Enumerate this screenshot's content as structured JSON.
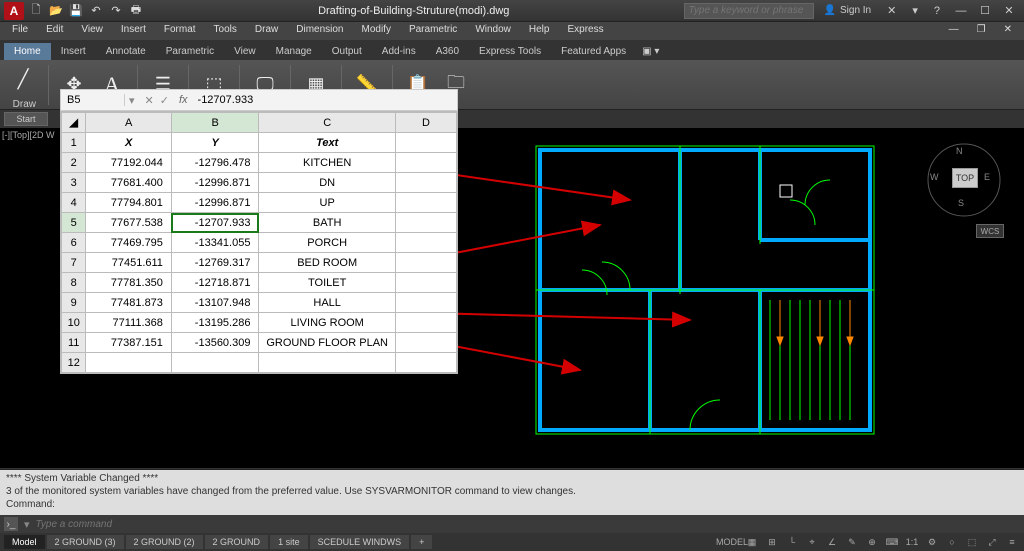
{
  "app": {
    "logo": "A",
    "title": "Drafting-of-Building-Struture(modi).dwg",
    "search_placeholder": "Type a keyword or phrase",
    "signin": "Sign In"
  },
  "menubar": [
    "File",
    "Edit",
    "View",
    "Insert",
    "Format",
    "Tools",
    "Draw",
    "Dimension",
    "Modify",
    "Parametric",
    "Window",
    "Help",
    "Express"
  ],
  "ribbon_tabs": [
    "Home",
    "Insert",
    "Annotate",
    "Parametric",
    "View",
    "Manage",
    "Output",
    "Add-ins",
    "A360",
    "Express Tools",
    "Featured Apps"
  ],
  "ribbon_active": 0,
  "ribbon_group_label": "Draw",
  "start_tab": "Start",
  "viewport_label": "[-][Top][2D W",
  "excel": {
    "namebox": "B5",
    "fx_label": "fx",
    "formula": "-12707.933",
    "cols": [
      "A",
      "B",
      "C",
      "D"
    ],
    "headers": [
      "X",
      "Y",
      "Text",
      ""
    ],
    "rows": [
      {
        "n": 2,
        "x": "77192.044",
        "y": "-12796.478",
        "t": "KITCHEN"
      },
      {
        "n": 3,
        "x": "77681.400",
        "y": "-12996.871",
        "t": "DN"
      },
      {
        "n": 4,
        "x": "77794.801",
        "y": "-12996.871",
        "t": "UP"
      },
      {
        "n": 5,
        "x": "77677.538",
        "y": "-12707.933",
        "t": "BATH"
      },
      {
        "n": 6,
        "x": "77469.795",
        "y": "-13341.055",
        "t": "PORCH"
      },
      {
        "n": 7,
        "x": "77451.611",
        "y": "-12769.317",
        "t": "BED ROOM"
      },
      {
        "n": 8,
        "x": "77781.350",
        "y": "-12718.871",
        "t": "TOILET"
      },
      {
        "n": 9,
        "x": "77481.873",
        "y": "-13107.948",
        "t": "HALL"
      },
      {
        "n": 10,
        "x": "77111.368",
        "y": "-13195.286",
        "t": "LIVING ROOM"
      },
      {
        "n": 11,
        "x": "77387.151",
        "y": "-13560.309",
        "t": "GROUND FLOOR PLAN"
      },
      {
        "n": 12,
        "x": "",
        "y": "",
        "t": ""
      }
    ],
    "selected_cell": "B5"
  },
  "viewcube": {
    "top": "TOP",
    "n": "N",
    "s": "S",
    "e": "E",
    "w": "W"
  },
  "wcs": "WCS",
  "cmd": {
    "hist_lines": [
      "**** System Variable Changed ****",
      "3 of the monitored system variables have changed from the preferred value. Use SYSVARMONITOR command to view changes.",
      "Command:"
    ],
    "placeholder": "Type a command"
  },
  "status": {
    "tabs": [
      "Model",
      "2 GROUND (3)",
      "2 GROUND (2)",
      "2 GROUND",
      "1 site",
      "SCEDULE WINDWS",
      "+"
    ],
    "active": 0,
    "right": [
      "MODEL",
      "▦",
      "⊞",
      "└",
      "⌖",
      "∠",
      "✎",
      "⊕",
      "⌨",
      "1:1",
      "⚙",
      "○",
      "⬚",
      "⤢",
      "≡"
    ]
  }
}
